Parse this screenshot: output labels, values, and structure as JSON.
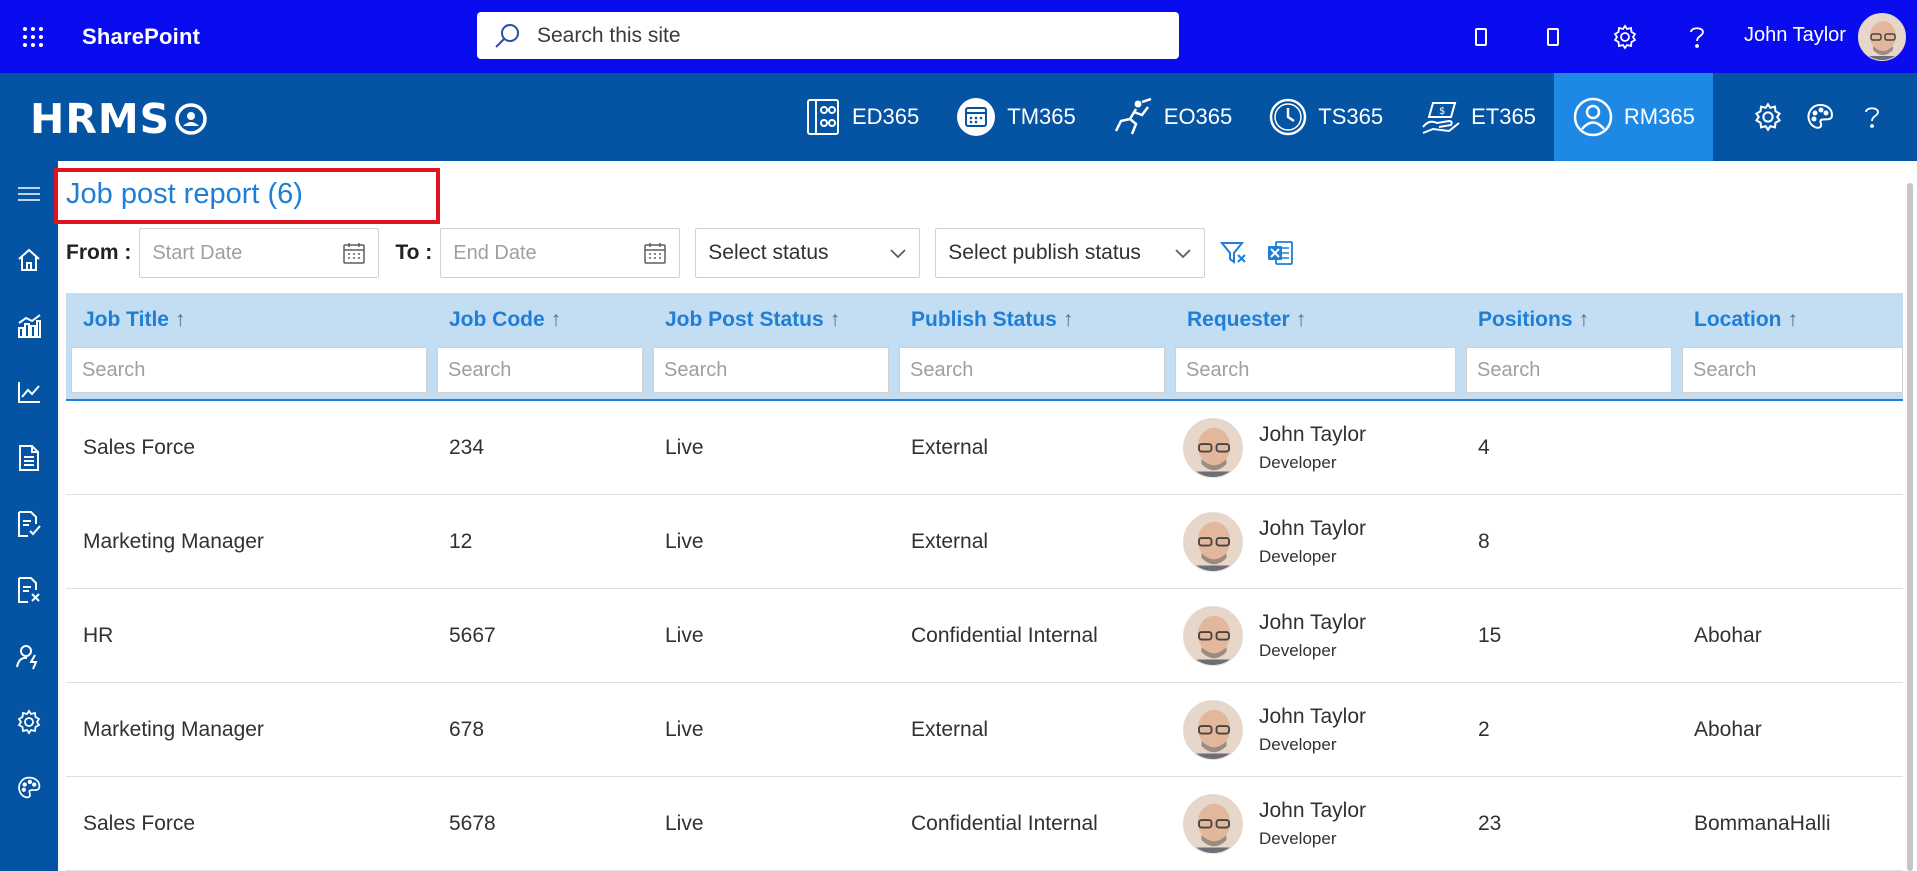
{
  "suite_bar": {
    "app_name": "SharePoint",
    "search_placeholder": "Search this site",
    "user_name": "John Taylor",
    "icons": [
      "waffle-icon",
      "search-icon",
      "mobile-icon",
      "mobile-icon",
      "gear-icon",
      "help-icon"
    ]
  },
  "app_header": {
    "logo_text": "HRMS",
    "modules": [
      {
        "label": "ED365",
        "icon": "employee-directory-icon"
      },
      {
        "label": "TM365",
        "icon": "calendar-icon"
      },
      {
        "label": "EO365",
        "icon": "running-person-icon"
      },
      {
        "label": "TS365",
        "icon": "clock-icon"
      },
      {
        "label": "ET365",
        "icon": "expense-icon"
      },
      {
        "label": "RM365",
        "icon": "user-circle-icon",
        "active": true
      }
    ],
    "tools": [
      "gear-icon",
      "palette-icon",
      "help-icon"
    ]
  },
  "left_nav": [
    "menu-icon",
    "home-icon",
    "bar-chart-icon",
    "line-chart-icon",
    "document-icon",
    "document-check-icon",
    "document-close-icon",
    "user-flash-icon",
    "gear-icon",
    "palette-icon"
  ],
  "page": {
    "title": "Job post report (6)"
  },
  "filters": {
    "from_label": "From :",
    "start_placeholder": "Start Date",
    "to_label": "To :",
    "end_placeholder": "End Date",
    "status_placeholder": "Select status",
    "publish_placeholder": "Select publish status"
  },
  "table": {
    "sort_arrow": "↑",
    "search_placeholder": "Search",
    "columns": [
      "Job Title",
      "Job Code",
      "Job Post Status",
      "Publish Status",
      "Requester",
      "Positions",
      "Location"
    ],
    "rows": [
      {
        "title": "Sales Force",
        "code": "234",
        "status": "Live",
        "publish": "External",
        "req_name": "John Taylor",
        "req_role": "Developer",
        "positions": "4",
        "location": ""
      },
      {
        "title": "Marketing Manager",
        "code": "12",
        "status": "Live",
        "publish": "External",
        "req_name": "John Taylor",
        "req_role": "Developer",
        "positions": "8",
        "location": ""
      },
      {
        "title": "HR",
        "code": "5667",
        "status": "Live",
        "publish": "Confidential Internal",
        "req_name": "John Taylor",
        "req_role": "Developer",
        "positions": "15",
        "location": "Abohar"
      },
      {
        "title": "Marketing Manager",
        "code": "678",
        "status": "Live",
        "publish": "External",
        "req_name": "John Taylor",
        "req_role": "Developer",
        "positions": "2",
        "location": "Abohar"
      },
      {
        "title": "Sales Force",
        "code": "5678",
        "status": "Live",
        "publish": "Confidential Internal",
        "req_name": "John Taylor",
        "req_role": "Developer",
        "positions": "23",
        "location": "BommanaHalli"
      }
    ]
  },
  "colors": {
    "suite_bar": "#0a0cf0",
    "app_header": "#0553a3",
    "active_module": "#1e88e5",
    "accent": "#1f7ed6",
    "header_row": "#c3ddf3",
    "highlight_box": "#e0141e"
  }
}
